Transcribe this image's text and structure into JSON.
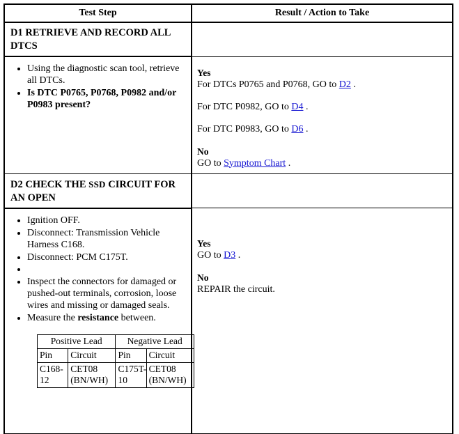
{
  "table": {
    "headers": {
      "test_step": "Test Step",
      "result_action": "Result / Action to Take"
    },
    "sections": [
      {
        "id": "D1",
        "title_prefix": "D1 RETRIEVE AND RECORD ALL",
        "title_small": "",
        "title_suffix": " DTCS",
        "title_full": "D1 RETRIEVE AND RECORD ALL DTCS",
        "steps": [
          {
            "text": "Using the diagnostic scan tool, retrieve all DTCs.",
            "bold": false
          },
          {
            "text": "Is DTC P0765, P0768, P0982 and/or P0983 present?",
            "bold": true
          }
        ],
        "results": {
          "yes_label": "Yes",
          "yes_lines": [
            {
              "pre": "For DTCs P0765 and P0768, GO to ",
              "link": "D2",
              "post": " ."
            },
            {
              "pre": "For DTC P0982, GO to ",
              "link": "D4",
              "post": " ."
            },
            {
              "pre": "For DTC P0983, GO to ",
              "link": "D6",
              "post": " ."
            }
          ],
          "no_label": "No",
          "no_lines": [
            {
              "pre": "GO to ",
              "link": "Symptom Chart",
              "post": " ."
            }
          ]
        }
      },
      {
        "id": "D2",
        "title_prefix": "D2 CHECK THE ",
        "title_small": "SSD",
        "title_suffix": " CIRCUIT FOR AN OPEN",
        "title_full": "D2 CHECK THE SSD CIRCUIT FOR AN OPEN",
        "steps": [
          {
            "text": "Ignition OFF.",
            "bold": false
          },
          {
            "text": "Disconnect: Transmission Vehicle Harness C168.",
            "bold": false
          },
          {
            "text": "Disconnect: PCM C175T.",
            "bold": false
          },
          {
            "text": "",
            "bold": false
          },
          {
            "text": "Inspect the connectors for damaged or pushed-out terminals, corrosion, loose wires and missing or damaged seals.",
            "bold": false
          },
          {
            "pre": "Measure the ",
            "bold_word": "resistance",
            "post": " between.",
            "bold": false
          }
        ],
        "lead_table": {
          "group_headers": [
            "Positive Lead",
            "Negative Lead"
          ],
          "sub_headers": [
            "Pin",
            "Circuit",
            "Pin",
            "Circuit"
          ],
          "rows": [
            [
              "C168-12",
              "CET08 (BN/WH)",
              "C175T-10",
              "CET08 (BN/WH)"
            ]
          ]
        },
        "results": {
          "yes_label": "Yes",
          "yes_lines": [
            {
              "pre": "GO to ",
              "link": "D3",
              "post": " ."
            }
          ],
          "no_label": "No",
          "no_lines": [
            {
              "pre": "REPAIR the circuit.",
              "link": "",
              "post": ""
            }
          ]
        }
      }
    ]
  },
  "colors": {
    "link": "#1414d2",
    "border": "#000000",
    "background": "#ffffff",
    "text": "#000000"
  }
}
